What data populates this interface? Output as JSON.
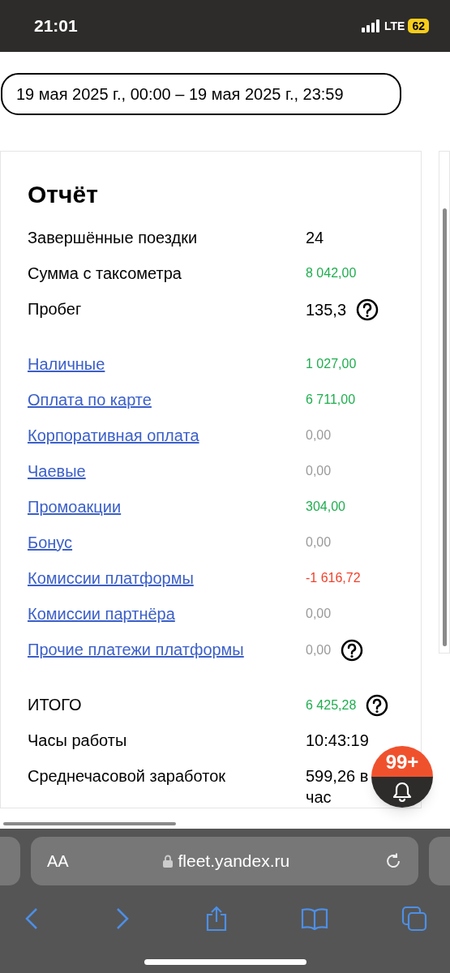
{
  "status_bar": {
    "time": "21:01",
    "network": "LTE",
    "battery": "62"
  },
  "date_range": "19 мая 2025 г., 00:00 – 19 мая 2025 г., 23:59",
  "report": {
    "title": "Отчёт",
    "groups": [
      [
        {
          "kind": "plain",
          "label": "Завершённые поездки",
          "value": "24",
          "help": false
        },
        {
          "kind": "plain",
          "label": "Сумма с таксометра",
          "value": "8 042,00",
          "color": "#1fae4f",
          "help": false
        },
        {
          "kind": "plain",
          "label": "Пробег",
          "value": "135,3",
          "help": true
        }
      ],
      [
        {
          "kind": "link",
          "label": "Наличные",
          "value": "1 027,00",
          "color": "#1fae4f",
          "help": false
        },
        {
          "kind": "link",
          "label": "Оплата по карте",
          "value": "6 711,00",
          "color": "#1fae4f",
          "help": false
        },
        {
          "kind": "link",
          "label": "Корпоративная оплата",
          "value": "0,00",
          "color": "#9a9a9a",
          "help": false
        },
        {
          "kind": "link",
          "label": "Чаевые",
          "value": "0,00",
          "color": "#9a9a9a",
          "help": false
        },
        {
          "kind": "link",
          "label": "Промоакции",
          "value": "304,00",
          "color": "#1fae4f",
          "help": false
        },
        {
          "kind": "link",
          "label": "Бонус",
          "value": "0,00",
          "color": "#9a9a9a",
          "help": false
        },
        {
          "kind": "link",
          "label": "Комиссии платформы",
          "value": "-1 616,72",
          "color": "#f0412c",
          "help": false
        },
        {
          "kind": "link",
          "label": "Комиссии партнёра",
          "value": "0,00",
          "color": "#9a9a9a",
          "help": false
        },
        {
          "kind": "link",
          "label": "Прочие платежи платформы",
          "value": "0,00",
          "color": "#9a9a9a",
          "help": true
        }
      ],
      [
        {
          "kind": "plain",
          "label": "ИТОГО",
          "value": "6 425,28",
          "color": "#1fae4f",
          "help": true
        },
        {
          "kind": "plain",
          "label": "Часы работы",
          "value": "10:43:19",
          "help": false
        },
        {
          "kind": "plain",
          "label": "Среднечасовой заработок",
          "value": "599,26 в час",
          "help": false
        }
      ]
    ]
  },
  "notifications": {
    "badge": "99+"
  },
  "browser": {
    "text_size": "AA",
    "url": "fleet.yandex.ru"
  }
}
